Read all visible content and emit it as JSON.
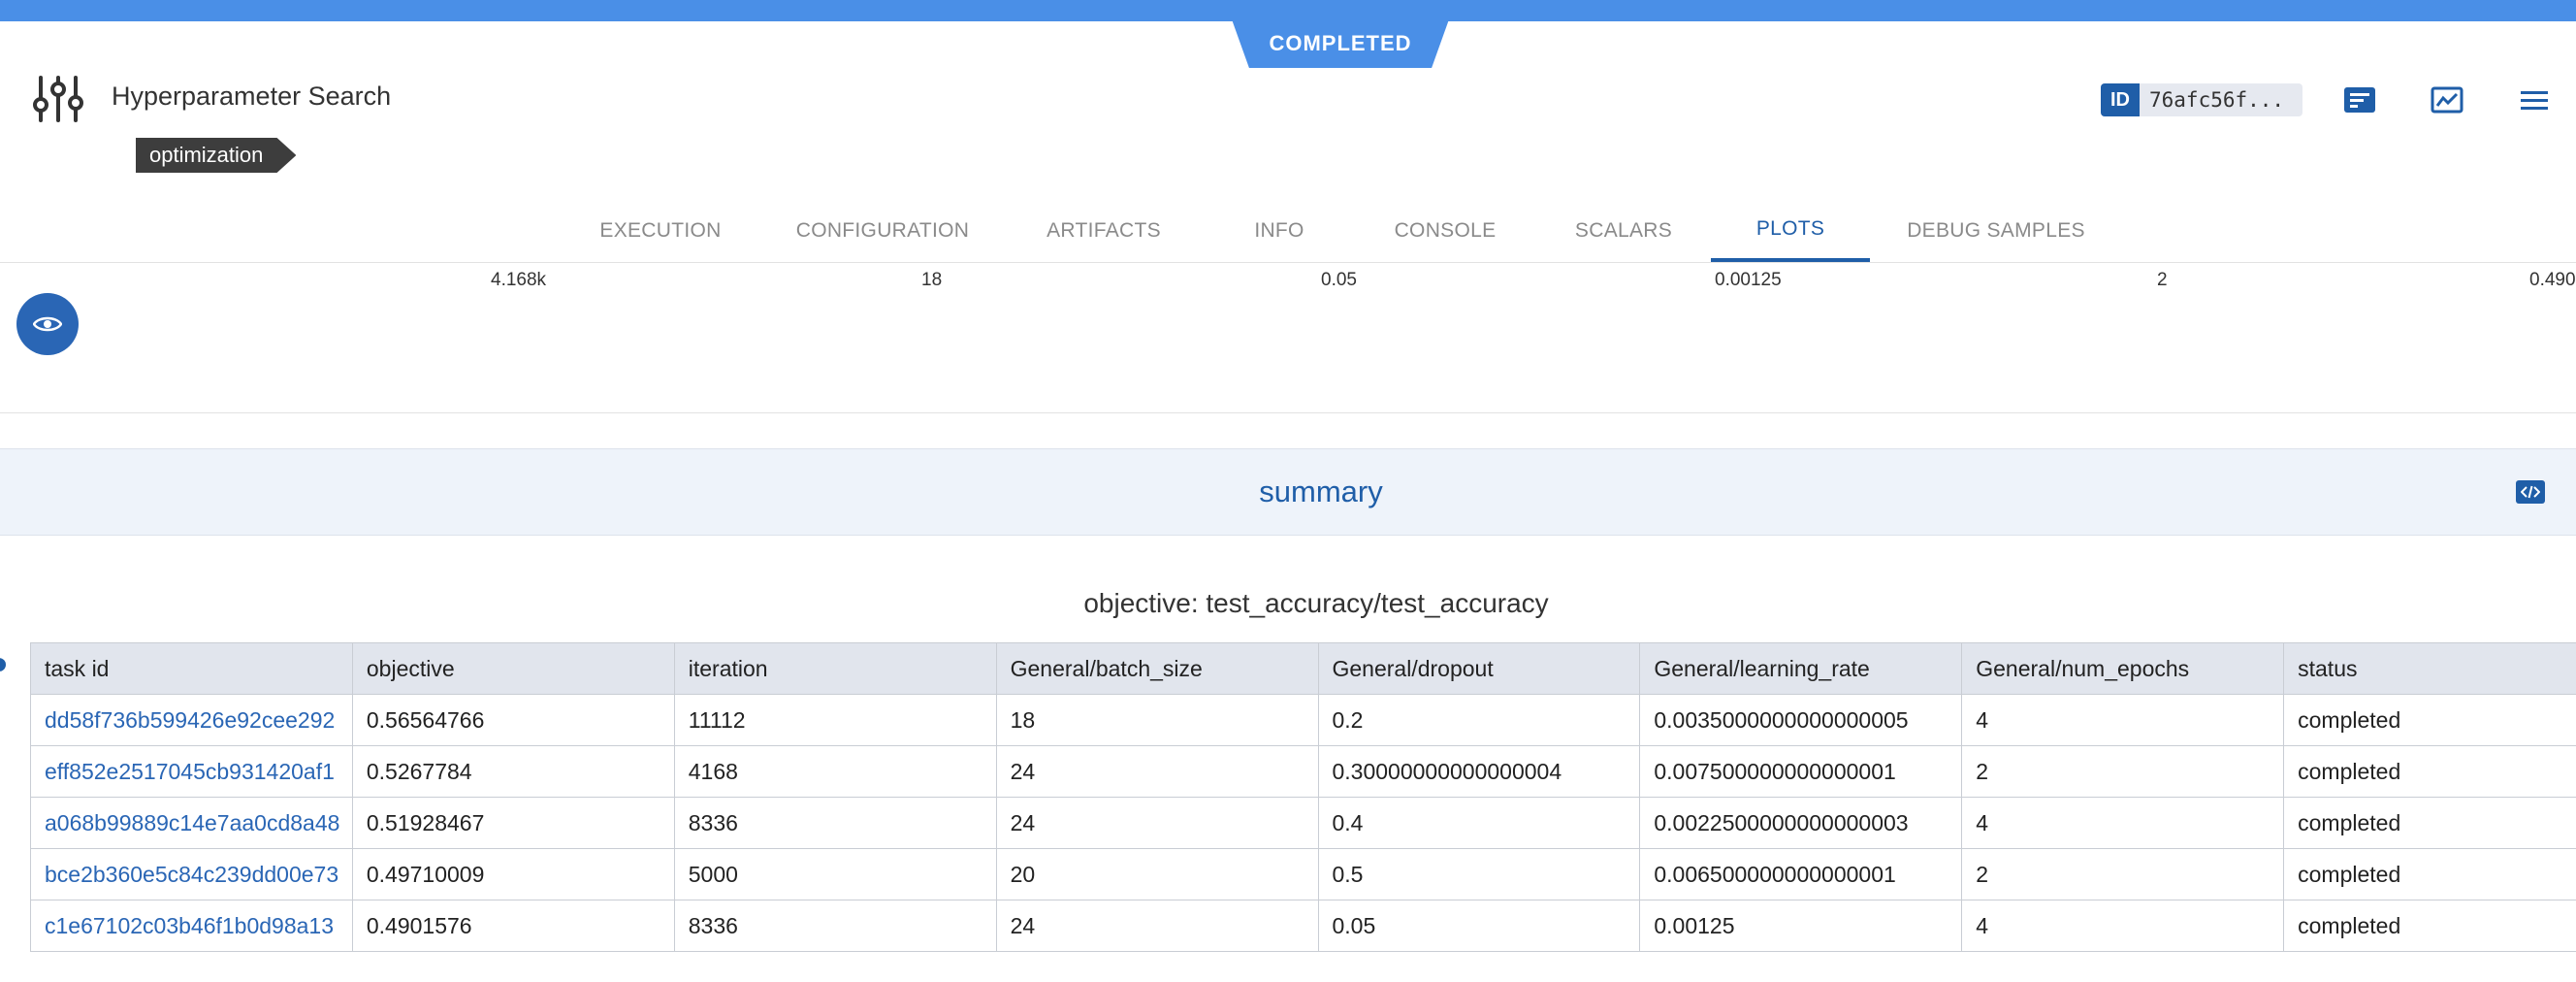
{
  "header": {
    "status": "COMPLETED",
    "title": "Hyperparameter Search",
    "tag": "optimization",
    "id_badge": "ID",
    "id_value": "76afc56f..."
  },
  "tabs": [
    {
      "label": "EXECUTION"
    },
    {
      "label": "CONFIGURATION"
    },
    {
      "label": "ARTIFACTS"
    },
    {
      "label": "INFO"
    },
    {
      "label": "CONSOLE"
    },
    {
      "label": "SCALARS"
    },
    {
      "label": "PLOTS",
      "active": true
    },
    {
      "label": "DEBUG SAMPLES"
    }
  ],
  "axis_values": [
    "4.168k",
    "18",
    "0.05",
    "0.00125",
    "2",
    "0.490"
  ],
  "summary": {
    "title": "summary",
    "objective_label": "objective: test_accuracy/test_accuracy"
  },
  "table": {
    "headers": [
      "task id",
      "objective",
      "iteration",
      "General/batch_size",
      "General/dropout",
      "General/learning_rate",
      "General/num_epochs",
      "status"
    ],
    "rows": [
      [
        "dd58f736b599426e92cee292",
        "0.56564766",
        "11112",
        "18",
        "0.2",
        "0.0035000000000000005",
        "4",
        "completed"
      ],
      [
        "eff852e2517045cb931420af1",
        "0.5267784",
        "4168",
        "24",
        "0.30000000000000004",
        "0.007500000000000001",
        "2",
        "completed"
      ],
      [
        "a068b99889c14e7aa0cd8a48",
        "0.51928467",
        "8336",
        "24",
        "0.4",
        "0.0022500000000000003",
        "4",
        "completed"
      ],
      [
        "bce2b360e5c84c239dd00e73",
        "0.49710009",
        "5000",
        "20",
        "0.5",
        "0.006500000000000001",
        "2",
        "completed"
      ],
      [
        "c1e67102c03b46f1b0d98a13",
        "0.4901576",
        "8336",
        "24",
        "0.05",
        "0.00125",
        "4",
        "completed"
      ]
    ]
  },
  "colors": {
    "accent": "#4a8fe7",
    "primary": "#1f5ea8",
    "link": "#2a66b5"
  }
}
